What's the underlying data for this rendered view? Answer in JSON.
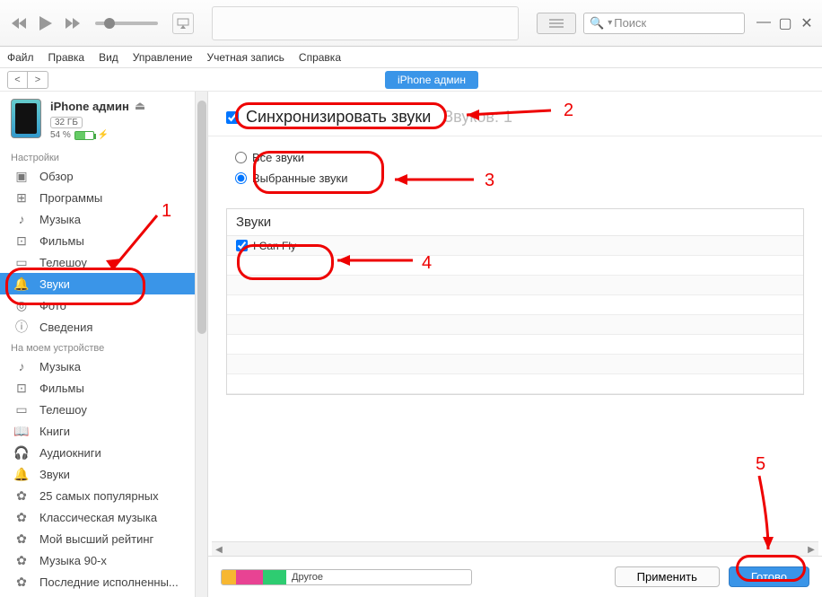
{
  "titlebar": {
    "search_placeholder": "Поиск"
  },
  "menubar": {
    "items": [
      "Файл",
      "Правка",
      "Вид",
      "Управление",
      "Учетная запись",
      "Справка"
    ],
    "device_pill": "iPhone админ"
  },
  "device": {
    "name": "iPhone админ",
    "capacity": "32 ГБ",
    "battery_pct": "54 %"
  },
  "sidebar": {
    "section_settings": "Настройки",
    "settings": [
      {
        "label": "Обзор",
        "icon": "▣"
      },
      {
        "label": "Программы",
        "icon": "⊞"
      },
      {
        "label": "Музыка",
        "icon": "♪"
      },
      {
        "label": "Фильмы",
        "icon": "⊡"
      },
      {
        "label": "Телешоу",
        "icon": "▭"
      },
      {
        "label": "Звуки",
        "icon": "🔔",
        "active": true
      },
      {
        "label": "Фото",
        "icon": "◎"
      },
      {
        "label": "Сведения",
        "icon": "ⓘ"
      }
    ],
    "section_device": "На моем устройстве",
    "device_items": [
      {
        "label": "Музыка",
        "icon": "♪"
      },
      {
        "label": "Фильмы",
        "icon": "⊡"
      },
      {
        "label": "Телешоу",
        "icon": "▭"
      },
      {
        "label": "Книги",
        "icon": "📖"
      },
      {
        "label": "Аудиокниги",
        "icon": "🎧"
      },
      {
        "label": "Звуки",
        "icon": "🔔"
      },
      {
        "label": "25 самых популярных",
        "icon": "✿"
      },
      {
        "label": "Классическая музыка",
        "icon": "✿"
      },
      {
        "label": "Мой высший рейтинг",
        "icon": "✿"
      },
      {
        "label": "Музыка 90-х",
        "icon": "✿"
      },
      {
        "label": "Последние исполненны...",
        "icon": "✿"
      }
    ]
  },
  "main": {
    "sync_label": "Синхронизировать звуки",
    "count_label": "Звуков: 1",
    "radio_all": "Все звуки",
    "radio_selected": "Выбранные звуки",
    "panel_title": "Звуки",
    "sounds": [
      {
        "name": "I Can Fly",
        "checked": true
      }
    ]
  },
  "footer": {
    "other_label": "Другое",
    "apply": "Применить",
    "done": "Готово"
  },
  "annotations": {
    "n1": "1",
    "n2": "2",
    "n3": "3",
    "n4": "4",
    "n5": "5"
  }
}
